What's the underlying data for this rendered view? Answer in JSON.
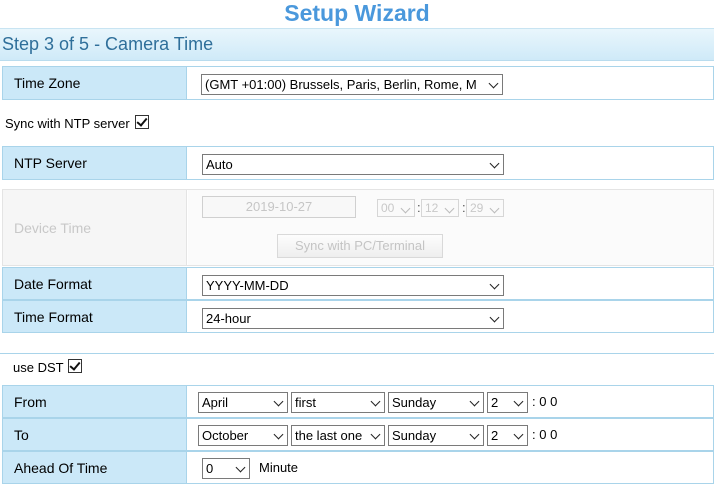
{
  "header": {
    "title": "Setup Wizard",
    "step": "Step 3 of 5 - Camera Time"
  },
  "time_zone": {
    "label": "Time Zone",
    "value": "(GMT +01:00) Brussels, Paris, Berlin, Rome, M"
  },
  "ntp_sync": {
    "label": "Sync with NTP server",
    "checked": true
  },
  "ntp_server": {
    "label": "NTP Server",
    "value": "Auto"
  },
  "device_time": {
    "label": "Device Time",
    "date": "2019-10-27",
    "hour": "00",
    "minute": "12",
    "second": "29",
    "colon1": ":",
    "colon2": ":",
    "sync_button": "Sync with PC/Terminal",
    "disabled": true
  },
  "date_format": {
    "label": "Date Format",
    "value": "YYYY-MM-DD"
  },
  "time_format": {
    "label": "Time Format",
    "value": "24-hour"
  },
  "dst": {
    "label": "use DST",
    "checked": true
  },
  "from": {
    "label": "From",
    "month": "April",
    "week": "first",
    "day": "Sunday",
    "hour": "2",
    "suffix": ": 0 0"
  },
  "to": {
    "label": "To",
    "month": "October",
    "week": "the last one",
    "day": "Sunday",
    "hour": "2",
    "suffix": ": 0 0"
  },
  "ahead": {
    "label": "Ahead Of Time",
    "value": "0",
    "unit": "Minute"
  },
  "colors": {
    "title": "#4a98dc",
    "label_bg": "#cbe8f8",
    "border": "#a9d4ea",
    "disabled_text": "#c8c8c8"
  }
}
